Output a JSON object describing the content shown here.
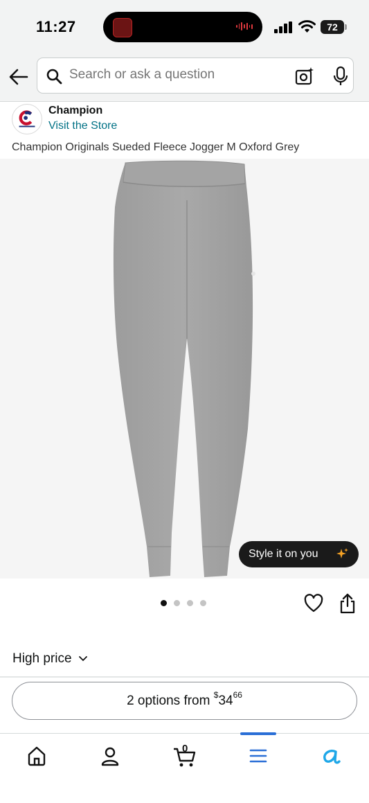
{
  "status_bar": {
    "time": "11:27",
    "battery": "72"
  },
  "search": {
    "placeholder": "Search or ask a question"
  },
  "store": {
    "name": "Champion",
    "link": "Visit the Store"
  },
  "product": {
    "title": "Champion Originals Sueded Fleece Jogger M Oxford Grey"
  },
  "style_button": {
    "label": "Style it on you"
  },
  "carousel": {
    "count": 4,
    "active_index": 0
  },
  "filter": {
    "label": "High price"
  },
  "options": {
    "prefix": "2 options from",
    "currency": "$",
    "whole": "34",
    "fraction": "66"
  },
  "tab_bar": {
    "items": [
      {
        "icon": "home-icon"
      },
      {
        "icon": "account-icon"
      },
      {
        "icon": "cart-icon",
        "badge": "0"
      },
      {
        "icon": "menu-icon",
        "active": true
      },
      {
        "icon": "rufus-icon"
      }
    ]
  },
  "colors": {
    "accent": "#007185",
    "tab_active": "#2a6fd6",
    "rufus": "#1ea7e8",
    "sparkle": "#f7a325"
  }
}
